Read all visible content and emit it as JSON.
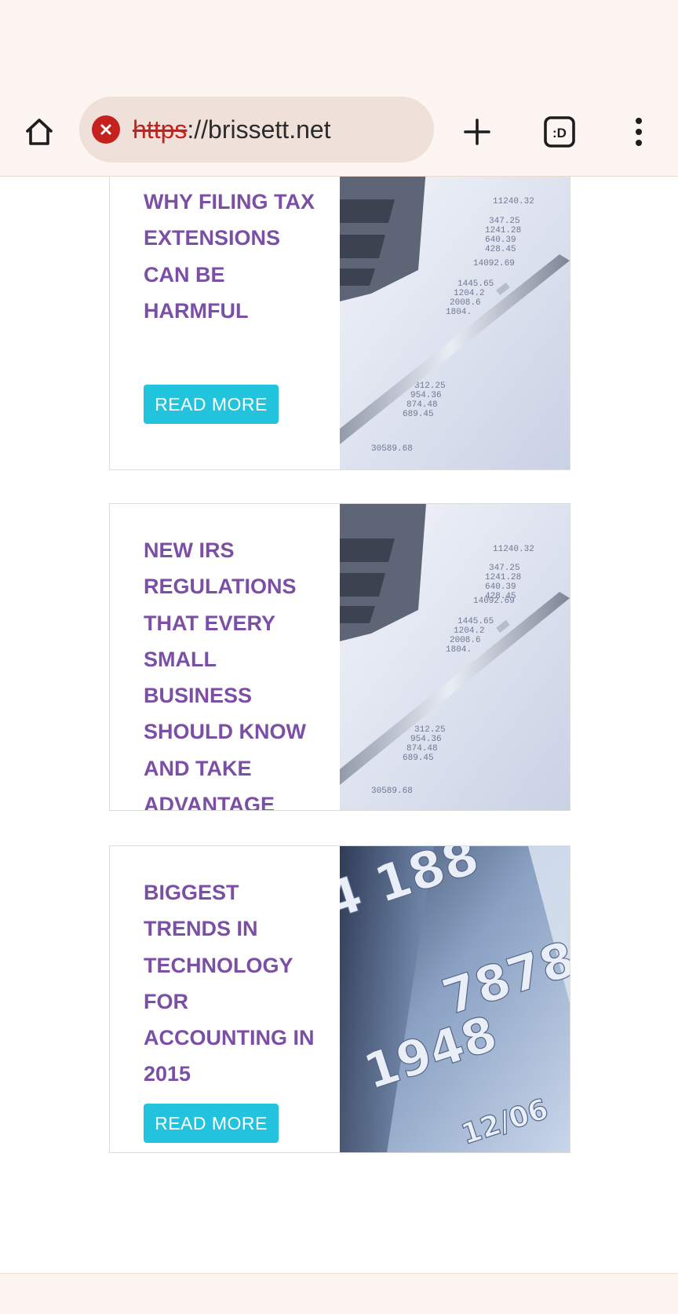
{
  "browser": {
    "url_scheme": "https",
    "url_rest": "://brissett.net",
    "tab_switcher_label": ":D",
    "icons": {
      "home": "home-icon",
      "security": "not-secure-icon",
      "new_tab": "plus-icon",
      "tabs": "tab-switcher-icon",
      "menu": "overflow-menu-icon"
    }
  },
  "articles": [
    {
      "title": "WHY FILING TAX EXTENSIONS CAN BE HARMFUL",
      "button": "READ MORE",
      "image": "calculator-pen-photo"
    },
    {
      "title": "NEW IRS REGULATIONS THAT EVERY SMALL BUSINESS SHOULD KNOW AND TAKE ADVANTAGE",
      "button": "",
      "image": "calculator-pen-photo"
    },
    {
      "title": "BIGGEST TRENDS IN TECHNOLOGY FOR ACCOUNTING IN 2015",
      "button": "READ MORE",
      "image": "credit-card-photo"
    }
  ],
  "colors": {
    "title": "#7b4fa6",
    "button": "#22c4dd",
    "chrome_bg": "#fdf5f2",
    "urlbar_bg": "#efe0d9",
    "not_secure": "#c5221f"
  }
}
